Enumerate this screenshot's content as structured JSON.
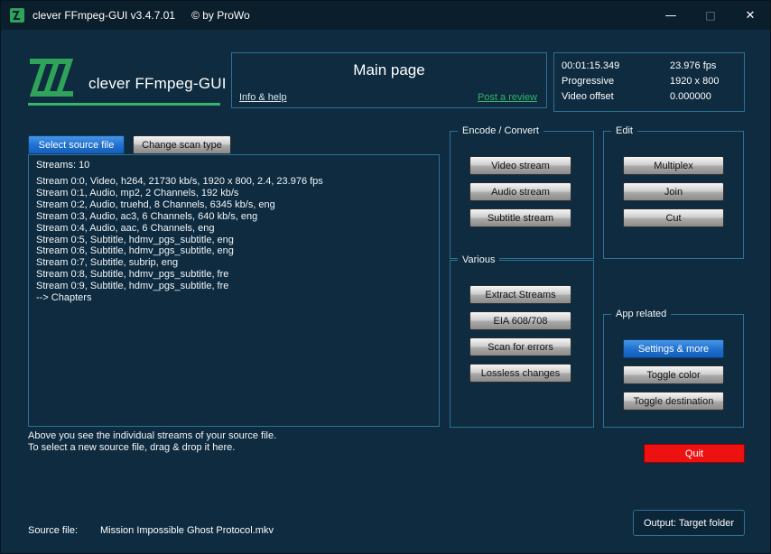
{
  "window": {
    "title": "clever FFmpeg-GUI v3.4.7.01",
    "copyright": "© by ProWo",
    "controls": {
      "minimize": "—",
      "maximize": "□",
      "close": "✕"
    }
  },
  "branding": {
    "logo_text": "clever FFmpeg-GUI"
  },
  "main_panel": {
    "title": "Main page",
    "info_link": "Info & help",
    "review_link": "Post a review"
  },
  "video_info": {
    "rows": [
      {
        "label": "00:01:15.349",
        "value": "23.976 fps"
      },
      {
        "label": "Progressive",
        "value": "1920 x 800"
      },
      {
        "label": "Video offset",
        "value": "0.000000"
      }
    ]
  },
  "toolbar": {
    "select_source": "Select source file",
    "change_scan": "Change scan type"
  },
  "streams": {
    "title": "Streams: 10",
    "list": [
      "Stream 0:0, Video, h264, 21730 kb/s, 1920 x 800, 2.4, 23.976 fps",
      "Stream 0:1, Audio, mp2, 2 Channels, 192 kb/s",
      "Stream 0:2, Audio, truehd, 8 Channels, 6345 kb/s, eng",
      "Stream 0:3, Audio, ac3, 6 Channels, 640 kb/s, eng",
      "Stream 0:4, Audio, aac, 6 Channels, eng",
      "Stream 0:5, Subtitle, hdmv_pgs_subtitle, eng",
      "Stream 0:6, Subtitle, hdmv_pgs_subtitle, eng",
      "Stream 0:7, Subtitle, subrip, eng",
      "Stream 0:8, Subtitle, hdmv_pgs_subtitle, fre",
      "Stream 0:9, Subtitle, hdmv_pgs_subtitle, fre",
      "--> Chapters"
    ],
    "hint1": "Above you see the individual streams of your source file.",
    "hint2": "To select a new source file, drag & drop it here."
  },
  "groups": {
    "encode": {
      "title": "Encode / Convert",
      "buttons": [
        "Video stream",
        "Audio stream",
        "Subtitle stream"
      ]
    },
    "edit": {
      "title": "Edit",
      "buttons": [
        "Multiplex",
        "Join",
        "Cut"
      ]
    },
    "various": {
      "title": "Various",
      "buttons": [
        "Extract Streams",
        "EIA 608/708",
        "Scan for errors",
        "Lossless changes"
      ]
    },
    "app": {
      "title": "App related",
      "buttons": [
        "Settings & more",
        "Toggle color",
        "Toggle destination"
      ]
    }
  },
  "footer": {
    "quit": "Quit",
    "output": "Output: Target folder",
    "source_label": "Source file:",
    "source_value": "Mission Impossible Ghost Protocol.mkv"
  },
  "colors": {
    "background": "#0e2b3f",
    "titlebar": "#0a1e2c",
    "panel_border": "#2e7195",
    "accent_green": "#35b369",
    "accent_blue": "#1f6fd0",
    "quit_red": "#ee1111"
  }
}
